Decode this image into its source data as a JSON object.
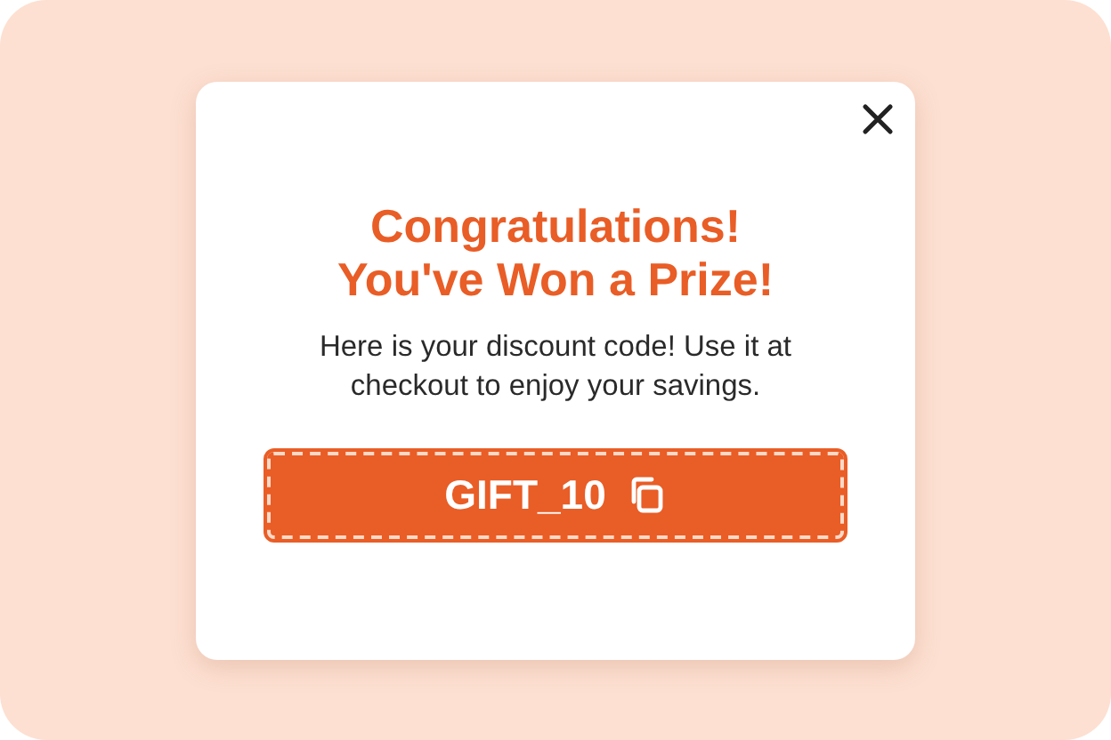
{
  "dialog": {
    "title": "Congratulations!\nYou've Won a Prize!",
    "message": "Here is your discount code! Use it at checkout to enjoy your savings.",
    "code": "GIFT_10"
  }
}
